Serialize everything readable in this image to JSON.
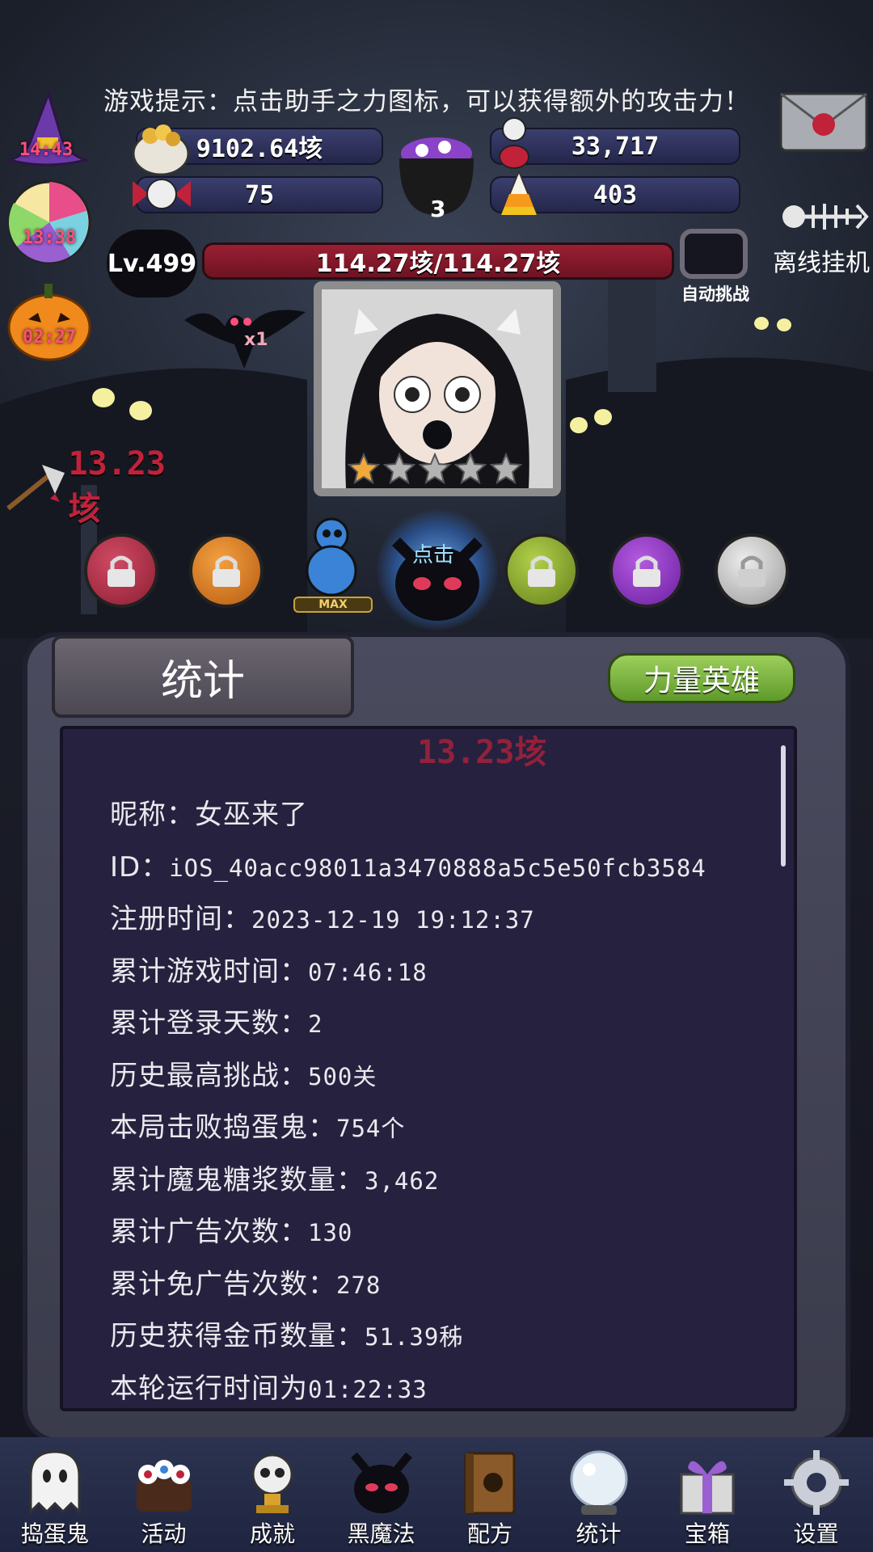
{
  "hint": "游戏提示：点击助手之力图标，可以获得额外的攻击力！",
  "resources": {
    "gold": "9102.64垓",
    "gems": "33,717",
    "candy_bow": "75",
    "candy_corn": "403",
    "cauldron_count": "3"
  },
  "timers": {
    "witch": "14:43",
    "lollipop": "13:38",
    "pumpkin": "02:27"
  },
  "level": "Lv.499",
  "hp": "114.27垓/114.27垓",
  "auto_challenge": "自动挑战",
  "offline": "离线挂机",
  "damage": "13.23垓",
  "damage_ghost": "13.23垓",
  "bat_multiplier": "x1",
  "tap_label": "点击",
  "max_label": "MAX",
  "stars_filled_fraction": 0.2,
  "panel": {
    "title": "统计",
    "hero_button": "力量英雄"
  },
  "stats": [
    {
      "label": "昵称：",
      "value": "女巫来了"
    },
    {
      "label": "ID：",
      "value": "iOS_40acc98011a3470888a5c5e50fcb3584"
    },
    {
      "label": "注册时间：",
      "value": "2023-12-19 19:12:37"
    },
    {
      "label": "累计游戏时间：",
      "value": "07:46:18"
    },
    {
      "label": "累计登录天数：",
      "value": "2"
    },
    {
      "label": "历史最高挑战：",
      "value": "500关"
    },
    {
      "label": "本局击败捣蛋鬼：",
      "value": "754个"
    },
    {
      "label": "累计魔鬼糖浆数量：",
      "value": "3,462"
    },
    {
      "label": "累计广告次数：",
      "value": "130"
    },
    {
      "label": "累计免广告次数：",
      "value": "278"
    },
    {
      "label": "历史获得金币数量：",
      "value": "51.39秭"
    },
    {
      "label": "本轮运行时间为",
      "value": "01:22:33"
    }
  ],
  "nav": [
    {
      "label": "捣蛋鬼",
      "icon": "ghost-icon"
    },
    {
      "label": "活动",
      "icon": "eyeball-cake-icon"
    },
    {
      "label": "成就",
      "icon": "skull-trophy-icon"
    },
    {
      "label": "黑魔法",
      "icon": "demon-head-icon"
    },
    {
      "label": "配方",
      "icon": "spellbook-icon"
    },
    {
      "label": "统计",
      "icon": "crystal-ball-icon"
    },
    {
      "label": "宝箱",
      "icon": "gift-box-icon"
    },
    {
      "label": "设置",
      "icon": "gear-icon"
    }
  ],
  "colors": {
    "timer": "#ff4f7a",
    "hp_bar": "#9a1f33",
    "hero_button": "#7cb545",
    "panel_inner": "#26213e"
  }
}
